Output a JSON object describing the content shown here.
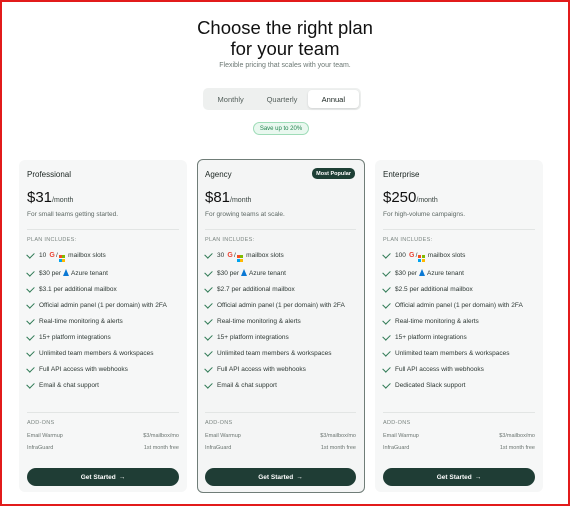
{
  "header": {
    "title_line1": "Choose the right plan",
    "title_line2": "for your team",
    "subtitle": "Flexible pricing that scales with your team."
  },
  "billing_toggle": {
    "options": [
      "Monthly",
      "Quarterly",
      "Annual"
    ],
    "selected": "Annual"
  },
  "save_badge": "Save up to 20%",
  "plans": [
    {
      "name": "Professional",
      "price": "$31",
      "period": "/month",
      "description": "For small teams getting started.",
      "includes_label": "PLAN INCLUDES:",
      "mailbox_slots_count": "10",
      "features": [
        "mailbox slots",
        "$30 per",
        "Azure tenant",
        "$3.1 per additional mailbox",
        "Official admin panel (1 per domain) with 2FA",
        "Real-time monitoring & alerts",
        "15+ platform integrations",
        "Unlimited team members & workspaces",
        "Full API access with webhooks",
        "Email & chat support"
      ],
      "addons_label": "ADD-ONS",
      "addons": [
        {
          "name": "Email Warmup",
          "price": "$3/mailbox/mo"
        },
        {
          "name": "InfraGuard",
          "price": "1st month free"
        }
      ],
      "cta": "Get Started"
    },
    {
      "name": "Agency",
      "badge": "Most Popular",
      "price": "$81",
      "period": "/month",
      "description": "For growing teams at scale.",
      "includes_label": "PLAN INCLUDES:",
      "mailbox_slots_count": "30",
      "features": [
        "mailbox slots",
        "$30 per",
        "Azure tenant",
        "$2.7 per additional mailbox",
        "Official admin panel (1 per domain) with 2FA",
        "Real-time monitoring & alerts",
        "15+ platform integrations",
        "Unlimited team members & workspaces",
        "Full API access with webhooks",
        "Email & chat support"
      ],
      "addons_label": "ADD-ONS",
      "addons": [
        {
          "name": "Email Warmup",
          "price": "$3/mailbox/mo"
        },
        {
          "name": "InfraGuard",
          "price": "1st month free"
        }
      ],
      "cta": "Get Started"
    },
    {
      "name": "Enterprise",
      "price": "$250",
      "period": "/month",
      "description": "For high-volume campaigns.",
      "includes_label": "PLAN INCLUDES:",
      "mailbox_slots_count": "100",
      "features": [
        "mailbox slots",
        "$30 per",
        "Azure tenant",
        "$2.5 per additional mailbox",
        "Official admin panel (1 per domain) with 2FA",
        "Real-time monitoring & alerts",
        "15+ platform integrations",
        "Unlimited team members & workspaces",
        "Full API access with webhooks",
        "Dedicated Slack support"
      ],
      "addons_label": "ADD-ONS",
      "addons": [
        {
          "name": "Email Warmup",
          "price": "$3/mailbox/mo"
        },
        {
          "name": "InfraGuard",
          "price": "1st month free"
        }
      ],
      "cta": "Get Started"
    }
  ],
  "colors": {
    "accent_dark_green": "#1f3d35",
    "check_green": "#2f7a55",
    "save_badge_green": "#23844f",
    "frame_red": "#e21b1b"
  },
  "icons": {
    "google": "google-icon",
    "microsoft": "microsoft-icon",
    "azure": "azure-icon",
    "check": "check-icon",
    "arrow": "arrow-right-icon"
  }
}
